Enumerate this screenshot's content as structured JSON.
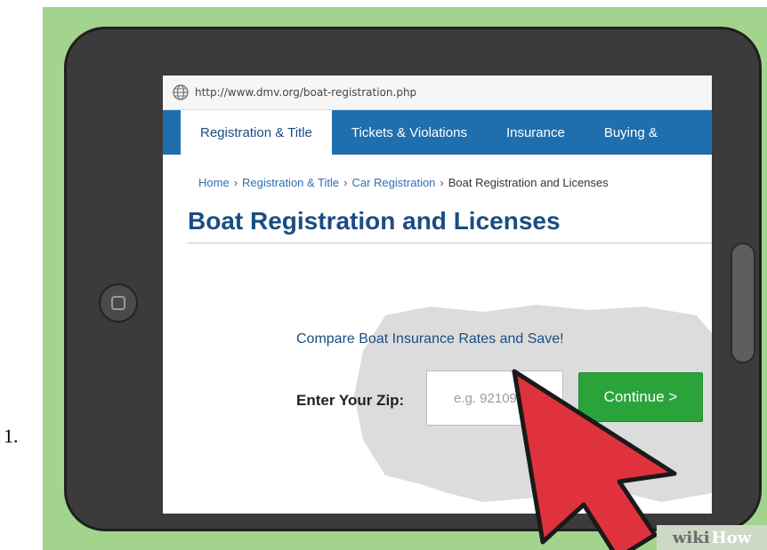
{
  "list": {
    "marker": "1."
  },
  "browser": {
    "url": "http://www.dmv.org/boat-registration.php"
  },
  "nav": {
    "tabs": [
      {
        "label": "Registration & Title",
        "active": true
      },
      {
        "label": "Tickets & Violations",
        "active": false
      },
      {
        "label": "Insurance",
        "active": false
      },
      {
        "label": "Buying &",
        "active": false
      }
    ]
  },
  "breadcrumb": {
    "home": "Home",
    "registration": "Registration & Title",
    "car": "Car Registration",
    "current": "Boat Registration and Licenses",
    "separator": "›"
  },
  "page": {
    "title": "Boat Registration and Licenses"
  },
  "form": {
    "promo": "Compare Boat Insurance Rates and Save!",
    "zip_label": "Enter Your Zip:",
    "zip_placeholder": "e.g. 92109",
    "continue_label": "Continue >"
  },
  "watermark": {
    "part1": "wiki",
    "part2": "How"
  },
  "icons": {
    "globe": "globe-icon",
    "cursor": "cursor-arrow-icon"
  },
  "colors": {
    "background": "#a3d48e",
    "nav_bar": "#1f6fae",
    "title": "#1a4d82",
    "continue_button": "#2aa43a",
    "cursor": "#e0323c"
  }
}
